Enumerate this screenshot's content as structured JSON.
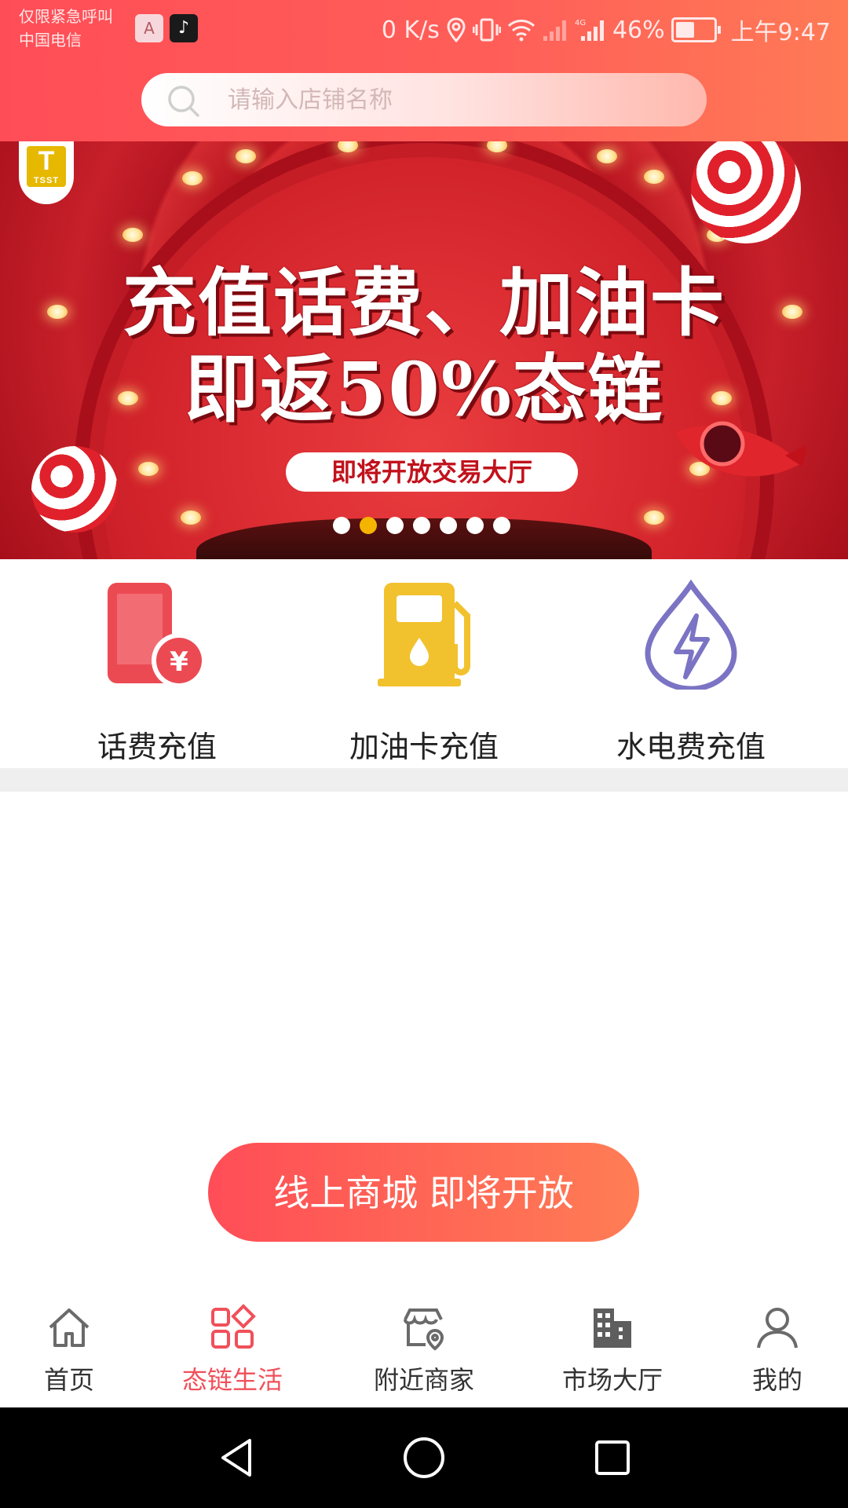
{
  "status_bar": {
    "emergency_text": "仅限紧急呼叫",
    "carrier": "中国电信",
    "app_icon_1": "A",
    "app_icon_2": "♪",
    "net_speed": "0 K/s",
    "network_type": "4G",
    "battery": "46%",
    "battery_level": 0.46,
    "time": "上午9:47"
  },
  "search": {
    "placeholder": "请输入店铺名称"
  },
  "banner": {
    "logo_letter": "T",
    "logo_text": "TSST",
    "title_line1": "充值话费、加油卡",
    "title_line2": "即返50%态链",
    "pill": "即将开放交易大厅",
    "dots_count": 7,
    "active_dot": 1
  },
  "quick_actions": [
    {
      "label": "话费充值",
      "icon": "phone-recharge-icon",
      "color": "#e8474f"
    },
    {
      "label": "加油卡充值",
      "icon": "fuel-pump-icon",
      "color": "#f2c12e"
    },
    {
      "label": "水电费充值",
      "icon": "water-electric-icon",
      "color": "#7b74c4"
    }
  ],
  "cta": {
    "label": "线上商城 即将开放"
  },
  "tabs": [
    {
      "label": "首页",
      "icon": "home-icon",
      "active": false
    },
    {
      "label": "态链生活",
      "icon": "grid-apps-icon",
      "active": true
    },
    {
      "label": "附近商家",
      "icon": "nearby-shop-icon",
      "active": false
    },
    {
      "label": "市场大厅",
      "icon": "building-icon",
      "active": false
    },
    {
      "label": "我的",
      "icon": "user-icon",
      "active": false
    }
  ],
  "colors": {
    "accent": "#ff5a58",
    "active_tab": "#f0505a",
    "dot_active": "#f5b400"
  }
}
